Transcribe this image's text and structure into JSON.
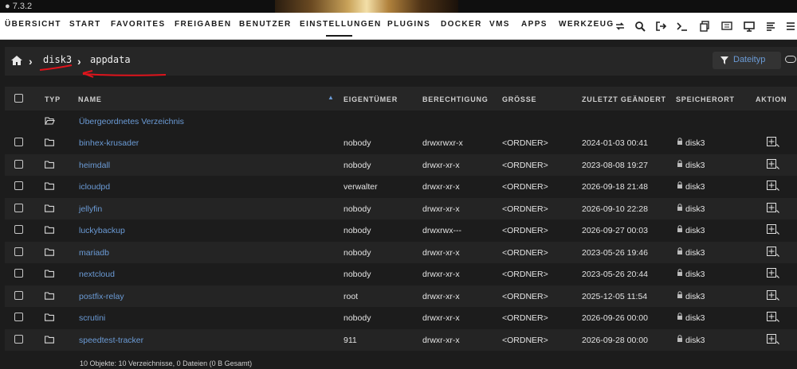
{
  "version": "7.3.2",
  "nav": {
    "items": [
      "ÜBERSICHT",
      "START",
      "FAVORITES",
      "FREIGABEN",
      "BENUTZER",
      "EINSTELLUNGEN",
      "PLUGINS",
      "DOCKER",
      "VMS",
      "APPS",
      "WERKZEUG"
    ],
    "active": "EINSTELLUNGEN",
    "icons": [
      "refresh-icon",
      "search-icon",
      "logout-icon",
      "terminal-icon",
      "copy-icon",
      "feedback-icon",
      "info-icon",
      "display-icon",
      "log-icon",
      "more-icon"
    ]
  },
  "breadcrumb": {
    "items": [
      "disk3",
      "appdata"
    ],
    "home_icon": "home-icon"
  },
  "filter": {
    "label": "Dateityp",
    "icon": "filter-icon"
  },
  "table": {
    "headers": {
      "type": "TYP",
      "name": "NAME",
      "owner": "EIGENTÜMER",
      "permission": "BERECHTIGUNG",
      "size": "GRÖSSE",
      "modified": "ZULETZT GEÄNDERT",
      "location": "SPEICHERORT",
      "action": "AKTION"
    },
    "sort_indicator": "▲",
    "parent": "Übergeordnetes Verzeichnis",
    "rows": [
      {
        "name": "binhex-krusader",
        "owner": "nobody",
        "perm": "drwxrwxr-x",
        "size": "<ORDNER>",
        "modified": "2024-01-03 00:41",
        "location": "disk3"
      },
      {
        "name": "heimdall",
        "owner": "nobody",
        "perm": "drwxr-xr-x",
        "size": "<ORDNER>",
        "modified": "2023-08-08 19:27",
        "location": "disk3"
      },
      {
        "name": "icloudpd",
        "owner": "verwalter",
        "perm": "drwxr-xr-x",
        "size": "<ORDNER>",
        "modified": "2026-09-18 21:48",
        "location": "disk3"
      },
      {
        "name": "jellyfin",
        "owner": "nobody",
        "perm": "drwxr-xr-x",
        "size": "<ORDNER>",
        "modified": "2026-09-10 22:28",
        "location": "disk3"
      },
      {
        "name": "luckybackup",
        "owner": "nobody",
        "perm": "drwxrwx---",
        "size": "<ORDNER>",
        "modified": "2026-09-27 00:03",
        "location": "disk3"
      },
      {
        "name": "mariadb",
        "owner": "nobody",
        "perm": "drwxr-xr-x",
        "size": "<ORDNER>",
        "modified": "2023-05-26 19:46",
        "location": "disk3"
      },
      {
        "name": "nextcloud",
        "owner": "nobody",
        "perm": "drwxr-xr-x",
        "size": "<ORDNER>",
        "modified": "2023-05-26 20:44",
        "location": "disk3"
      },
      {
        "name": "postfix-relay",
        "owner": "root",
        "perm": "drwxr-xr-x",
        "size": "<ORDNER>",
        "modified": "2025-12-05 11:54",
        "location": "disk3"
      },
      {
        "name": "scrutini",
        "owner": "nobody",
        "perm": "drwxr-xr-x",
        "size": "<ORDNER>",
        "modified": "2026-09-26 00:00",
        "location": "disk3"
      },
      {
        "name": "speedtest-tracker",
        "owner": "911",
        "perm": "drwxr-xr-x",
        "size": "<ORDNER>",
        "modified": "2026-09-28 00:00",
        "location": "disk3"
      }
    ]
  },
  "footer": "10 Objekte: 10 Verzeichnisse, 0 Dateien (0 B Gesamt)",
  "colors": {
    "link": "#6b9bd6",
    "annotation": "#e0141c"
  }
}
